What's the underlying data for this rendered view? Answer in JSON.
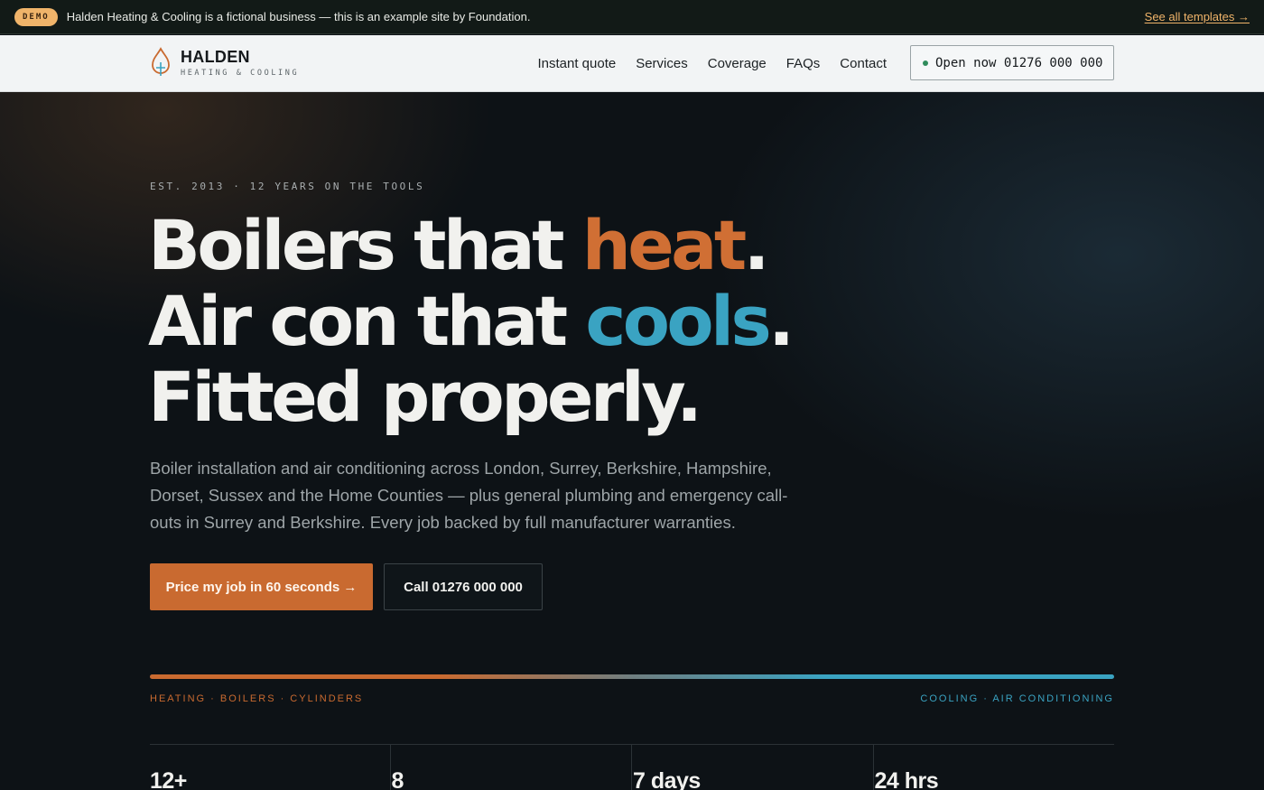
{
  "demo_bar": {
    "badge": "DEMO",
    "text": "Halden Heating & Cooling is a fictional business — this is an example site by Foundation.",
    "link": "See all templates →"
  },
  "header": {
    "logo_name": "HALDEN",
    "logo_sub": "HEATING & COOLING",
    "nav": [
      "Instant quote",
      "Services",
      "Coverage",
      "FAQs",
      "Contact"
    ],
    "open_button": "Open now 01276 000 000",
    "status_color": "#2f8c5c"
  },
  "hero": {
    "eyebrow": "EST. 2013 · 12 YEARS ON THE TOOLS",
    "line1_a": "Boilers that ",
    "line1_hot": "heat",
    "line1_end": ".",
    "line2_a": "Air con that ",
    "line2_cold": "cools",
    "line2_end": ".",
    "line3": "Fitted properly.",
    "lede": "Boiler installation and air conditioning across London, Surrey, Berkshire, Hampshire, Dorset, Sussex and the Home Counties — plus general plumbing and emergency call-outs in Surrey and Berkshire. Every job backed by full manufacturer warranties.",
    "primary_cta": "Price my job in 60 seconds →",
    "secondary_cta": "Call 01276 000 000",
    "tag_heating": "HEATING · BOILERS · CYLINDERS",
    "tag_cooling": "COOLING · AIR CONDITIONING",
    "stats": [
      "12+",
      "8",
      "7 days",
      "24 hrs"
    ]
  },
  "colors": {
    "accent_hot": "#c96a30",
    "accent_cold": "#3aa3c2",
    "demo_badge": "#f0b46a"
  }
}
